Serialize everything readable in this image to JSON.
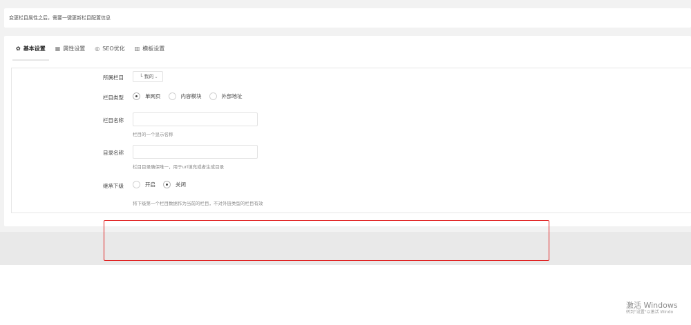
{
  "notice": {
    "text": "变更栏目属性之后，需要一键更新栏目配置信息"
  },
  "tabs": [
    {
      "icon": "gear-icon",
      "glyph": "✿",
      "label": "基本设置",
      "active": true
    },
    {
      "icon": "grid-icon",
      "glyph": "▦",
      "label": "属性设置",
      "active": false
    },
    {
      "icon": "seo-icon",
      "glyph": "◎",
      "label": "SEO优化",
      "active": false
    },
    {
      "icon": "template-icon",
      "glyph": "▥",
      "label": "模板设置",
      "active": false
    }
  ],
  "form": {
    "parent": {
      "label": "所属栏目",
      "selected": "└ 我的"
    },
    "type": {
      "label": "栏目类型",
      "options": [
        {
          "label": "单网页",
          "checked": true
        },
        {
          "label": "内容模块",
          "checked": false
        },
        {
          "label": "外部地址",
          "checked": false
        }
      ]
    },
    "name": {
      "label": "栏目名称",
      "value": "",
      "placeholder": "",
      "help": "栏目的一个显示名称"
    },
    "dir": {
      "label": "目录名称",
      "value": "",
      "placeholder": "",
      "help": "栏目目录确保唯一，用于url填充或者生成目录"
    },
    "inherit": {
      "label": "继承下级",
      "options": [
        {
          "label": "开启",
          "checked": false
        },
        {
          "label": "关闭",
          "checked": true
        }
      ],
      "help": "将下级第一个栏目数据作为当前的栏目，不对外链类型的栏目有效"
    }
  },
  "watermark": {
    "title": "激活 Windows",
    "subtitle": "转到\"设置\"以激活 Windo"
  },
  "colors": {
    "highlight": "#e02020",
    "page_bg": "#f2f2f2",
    "panel_bg": "#ffffff"
  }
}
